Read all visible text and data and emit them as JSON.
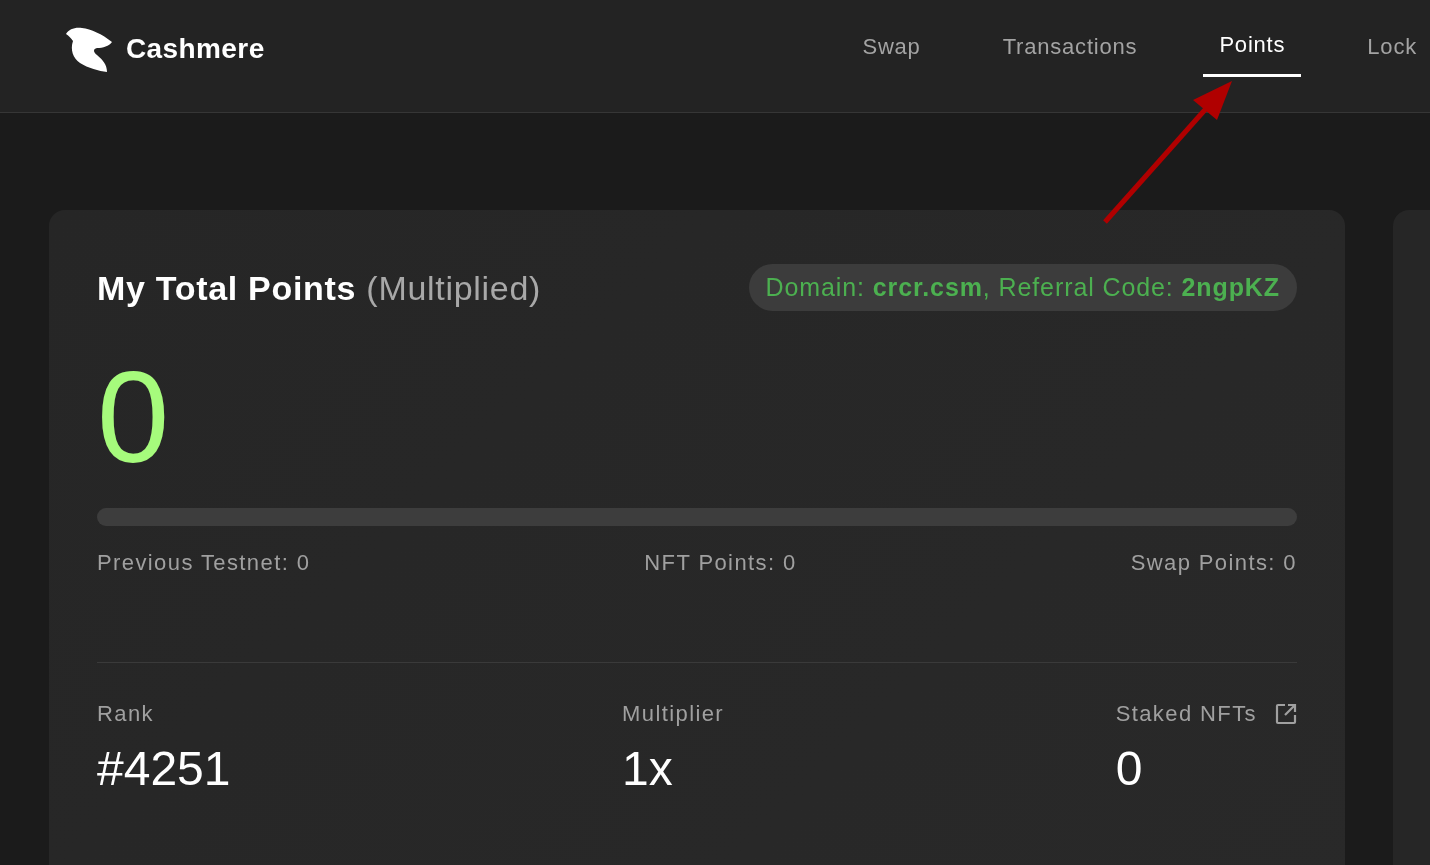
{
  "brand": {
    "name": "Cashmere"
  },
  "nav": [
    {
      "label": "Swap",
      "selected": false
    },
    {
      "label": "Transactions",
      "selected": false
    },
    {
      "label": "Points",
      "selected": true
    },
    {
      "label": "Lock",
      "selected": false
    }
  ],
  "points_card": {
    "title": "My Total Points",
    "title_note": "(Multiplied)",
    "referral_badge": "Domain: **crcr.csm**, Referral Code: **2ngpKZ**",
    "total": "0",
    "progress": {
      "level": 0
    },
    "breakdown": [
      "Previous Testnet: 0",
      "NFT Points: 0",
      "Swap Points: 0"
    ],
    "stats": [
      {
        "label": "Rank",
        "value": "#4251",
        "link": false
      },
      {
        "label": "Multiplier",
        "value": "1x",
        "link": false
      },
      {
        "label": "Staked NFTs",
        "value": "0",
        "link": true
      }
    ]
  }
}
